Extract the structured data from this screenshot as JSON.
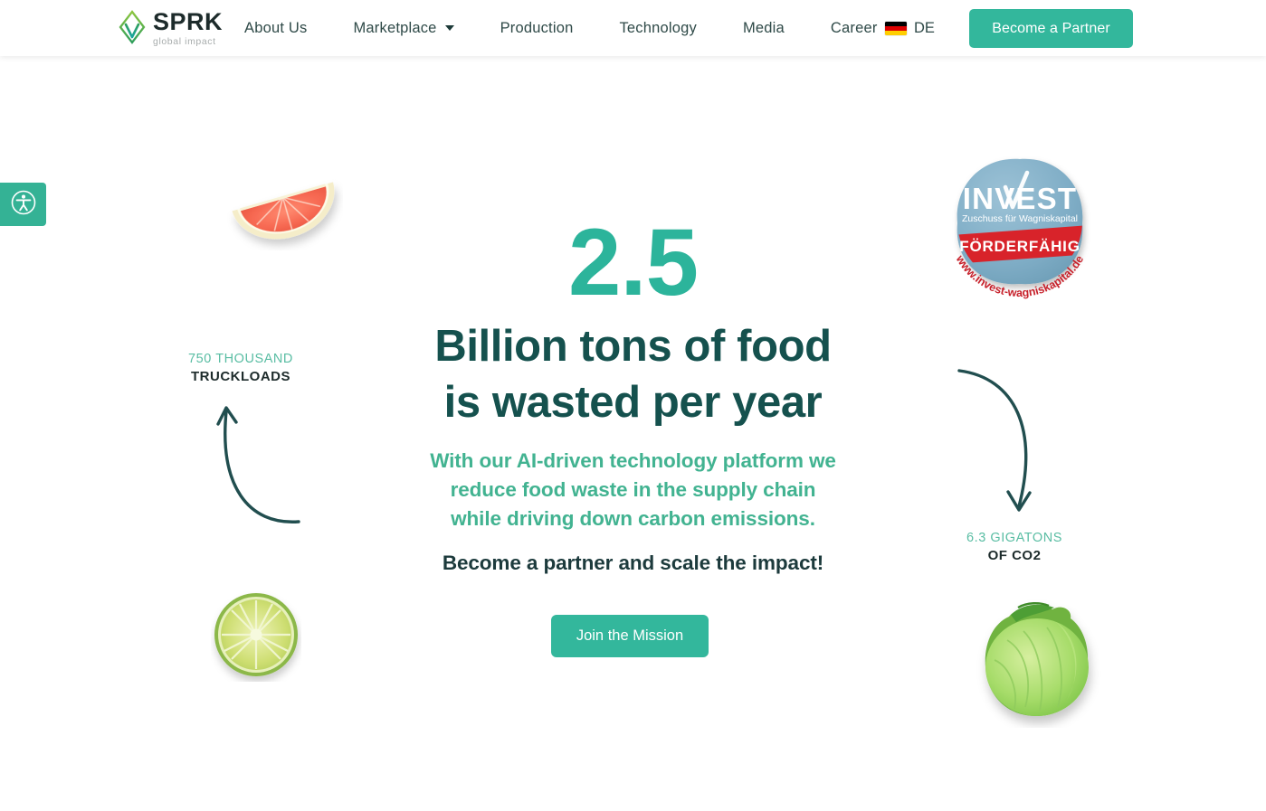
{
  "header": {
    "logo": {
      "word": "SPRK",
      "tagline": "global impact",
      "icon": "sprk-leaf-logo"
    },
    "nav": [
      {
        "label": "About Us",
        "has_dropdown": false
      },
      {
        "label": "Marketplace",
        "has_dropdown": true
      },
      {
        "label": "Production",
        "has_dropdown": false
      },
      {
        "label": "Technology",
        "has_dropdown": false
      },
      {
        "label": "Media",
        "has_dropdown": false
      },
      {
        "label": "Career",
        "has_dropdown": false
      }
    ],
    "language": {
      "code": "DE",
      "flag": "germany-flag-icon"
    },
    "cta": "Become a Partner"
  },
  "accessibility_widget": {
    "icon": "accessibility-icon",
    "label": "Accessibility"
  },
  "hero": {
    "big_number": "2.5",
    "headline_line1": "Billion tons of food",
    "headline_line2": "is wasted per year",
    "subline_line1": "With our AI-driven technology platform we",
    "subline_line2": "reduce food waste in the supply chain",
    "subline_line3": "while driving down carbon emissions.",
    "tagline": "Become a partner and scale the impact!",
    "cta": "Join the Mission"
  },
  "stats": {
    "left": {
      "value": "750 THOUSAND",
      "unit": "TRUCKLOADS"
    },
    "right": {
      "value": "6.3 GIGATONS",
      "unit": "OF CO2"
    }
  },
  "badge": {
    "title": "INVEST",
    "subtitle": "Zuschuss für Wagniskapital",
    "banner": "FÖRDERFÄHIG",
    "url": "www.invest-wagniskapital.de"
  },
  "decorations": [
    {
      "name": "grapefruit-slice"
    },
    {
      "name": "lime-slice"
    },
    {
      "name": "cabbage-head"
    }
  ],
  "colors": {
    "accent_teal": "#33b79c",
    "number_teal": "#2cb49b",
    "headline_dark": "#15514e",
    "subline_green": "#42b391",
    "stat_value": "#59bda3",
    "arrow_dark": "#1f4a4b",
    "badge_blue": "#7aadc6",
    "badge_red": "#d8232a"
  }
}
